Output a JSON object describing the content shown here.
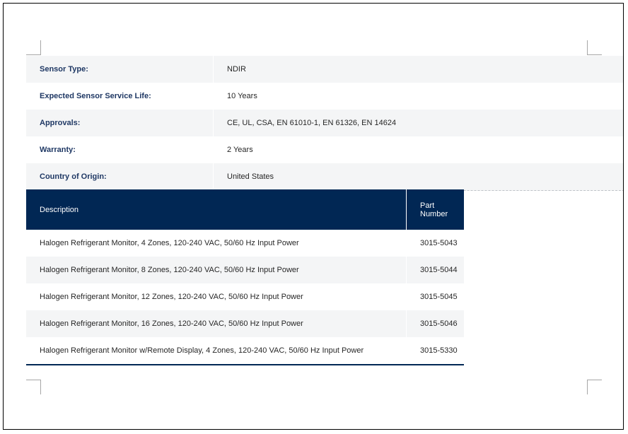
{
  "specs": [
    {
      "label": "Sensor Type:",
      "value": "NDIR"
    },
    {
      "label": "Expected Sensor Service Life:",
      "value": "10 Years"
    },
    {
      "label": "Approvals:",
      "value": "CE, UL, CSA, EN 61010-1, EN 61326, EN 14624"
    },
    {
      "label": "Warranty:",
      "value": "2 Years"
    },
    {
      "label": "Country of Origin:",
      "value": "United States"
    }
  ],
  "parts_table": {
    "headers": {
      "description": "Description",
      "part_number": "Part Number"
    },
    "rows": [
      {
        "description": "Halogen Refrigerant Monitor, 4 Zones, 120-240 VAC, 50/60 Hz Input Power",
        "part_number": "3015-5043"
      },
      {
        "description": "Halogen Refrigerant Monitor, 8 Zones, 120-240 VAC, 50/60 Hz Input Power",
        "part_number": "3015-5044"
      },
      {
        "description": "Halogen Refrigerant Monitor, 12 Zones, 120-240 VAC, 50/60 Hz Input Power",
        "part_number": "3015-5045"
      },
      {
        "description": "Halogen Refrigerant Monitor, 16 Zones, 120-240 VAC, 50/60 Hz Input Power",
        "part_number": "3015-5046"
      },
      {
        "description": "Halogen Refrigerant Monitor w/Remote Display, 4 Zones, 120-240 VAC, 50/60 Hz Input Power",
        "part_number": "3015-5330"
      }
    ]
  },
  "colors": {
    "header_bg": "#012754",
    "label_text": "#1f3864",
    "row_shade": "#f4f5f6"
  }
}
